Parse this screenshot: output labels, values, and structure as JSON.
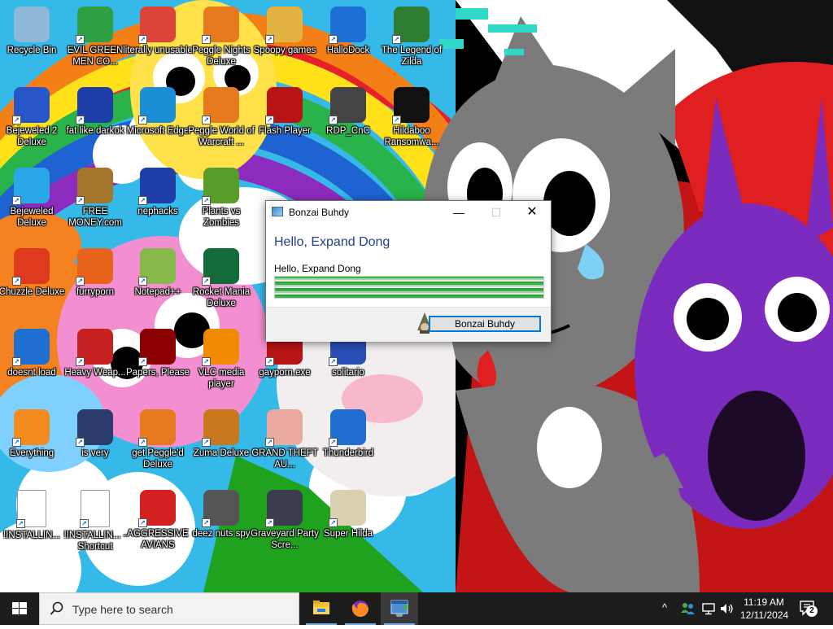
{
  "desktop": {
    "icons": [
      {
        "label": "Recycle Bin",
        "icon": "recycle-bin-icon"
      },
      {
        "label": "EVIL GREEN MEN CO...",
        "icon": "messenger-people-icon"
      },
      {
        "label": "literally unusable",
        "icon": "chrome-icon"
      },
      {
        "label": "Peggle Nights Deluxe",
        "icon": "peggle-icon"
      },
      {
        "label": "Spoopy games",
        "icon": "folder-icon"
      },
      {
        "label": "HalloDock",
        "icon": "windows-shield-icon"
      },
      {
        "label": "The Legend of Zilda",
        "icon": "zelda-character-icon"
      },
      {
        "label": "Bejeweled 2 Deluxe",
        "icon": "bejeweled-2-icon"
      },
      {
        "label": "fat like darkok",
        "icon": "mpi-logo-icon"
      },
      {
        "label": "Microsoft Edge",
        "icon": "edge-icon"
      },
      {
        "label": "Peggle World of Warcraft ...",
        "icon": "peggle-icon"
      },
      {
        "label": "Flash Player",
        "icon": "flash-icon"
      },
      {
        "label": "RDP_CnC",
        "icon": "rdp-icon"
      },
      {
        "label": "Hildaboo Ransomwa...",
        "icon": "yashma-icon"
      },
      {
        "label": "Bejeweled Deluxe",
        "icon": "diamond-icon"
      },
      {
        "label": "FREE MONEY.com",
        "icon": "money-bag-icon"
      },
      {
        "label": "nephacks",
        "icon": "mpi-logo-icon"
      },
      {
        "label": "Plants vs Zombies",
        "icon": "plants-vs-zombies-icon"
      },
      {
        "label": "Chuzzle Deluxe",
        "icon": "chuzzle-icon"
      },
      {
        "label": "furryporn",
        "icon": "firefox-icon"
      },
      {
        "label": "Notepad++",
        "icon": "notepad-plus-plus-icon"
      },
      {
        "label": "Rocket Mania Deluxe",
        "icon": "rocket-mania-icon"
      },
      {
        "label": "doesnt load",
        "icon": "thunderbird-icon"
      },
      {
        "label": "Heavy Weap...",
        "icon": "radiation-icon"
      },
      {
        "label": "Papers, Please",
        "icon": "papers-please-icon"
      },
      {
        "label": "VLC media player",
        "icon": "vlc-icon"
      },
      {
        "label": "gayporn.exe",
        "icon": "flash-icon"
      },
      {
        "label": "solitario",
        "icon": "solitaire-icon"
      },
      {
        "label": "Everything",
        "icon": "everything-search-icon"
      },
      {
        "label": "is very",
        "icon": "mpi-shield-icon"
      },
      {
        "label": "get Peggle'd Deluxe",
        "icon": "peggle-icon"
      },
      {
        "label": "Zuma Deluxe",
        "icon": "zuma-icon"
      },
      {
        "label": "GRAND THEFT AU...",
        "icon": "anime-girl-icon"
      },
      {
        "label": "Thunderbird",
        "icon": "thunderbird-icon"
      },
      {
        "label": "!INSTALLIN...",
        "icon": "text-document-icon"
      },
      {
        "label": "!INSTALLIN... - Shortcut",
        "icon": "text-document-icon"
      },
      {
        "label": "AGGRESSIVE AVIANS",
        "icon": "angry-birds-icon"
      },
      {
        "label": "deez nuts spy",
        "icon": "window-stack-icon"
      },
      {
        "label": "Graveyard Party Scre...",
        "icon": "graveyard-icon"
      },
      {
        "label": "Super Hilda",
        "icon": "pixel-character-icon"
      }
    ]
  },
  "dialog": {
    "title": "Bonzai Buhdy",
    "heading": "Hello, Expand Dong",
    "subtext": "Hello, Expand Dong",
    "progress": 1.0,
    "button_label": "Bonzai Buhdy",
    "controls": {
      "minimize": "—",
      "maximize": "☐",
      "close": "✕"
    }
  },
  "taskbar": {
    "search_placeholder": "Type here to search",
    "apps": [
      {
        "name": "file-explorer",
        "icon": "folder-icon"
      },
      {
        "name": "firefox",
        "icon": "firefox-icon"
      },
      {
        "name": "bonzai-buhdy",
        "icon": "bonzai-app-icon",
        "active": true
      }
    ],
    "tray": {
      "chevron": "^",
      "time": "11:19 AM",
      "date": "12/11/2024",
      "notifications": "2"
    }
  },
  "colors": {
    "taskbar_bg": "#1c1c1c",
    "dialog_heading": "#1f3f8f",
    "accent": "#0078d7",
    "progress_green": "#3fb24f"
  }
}
